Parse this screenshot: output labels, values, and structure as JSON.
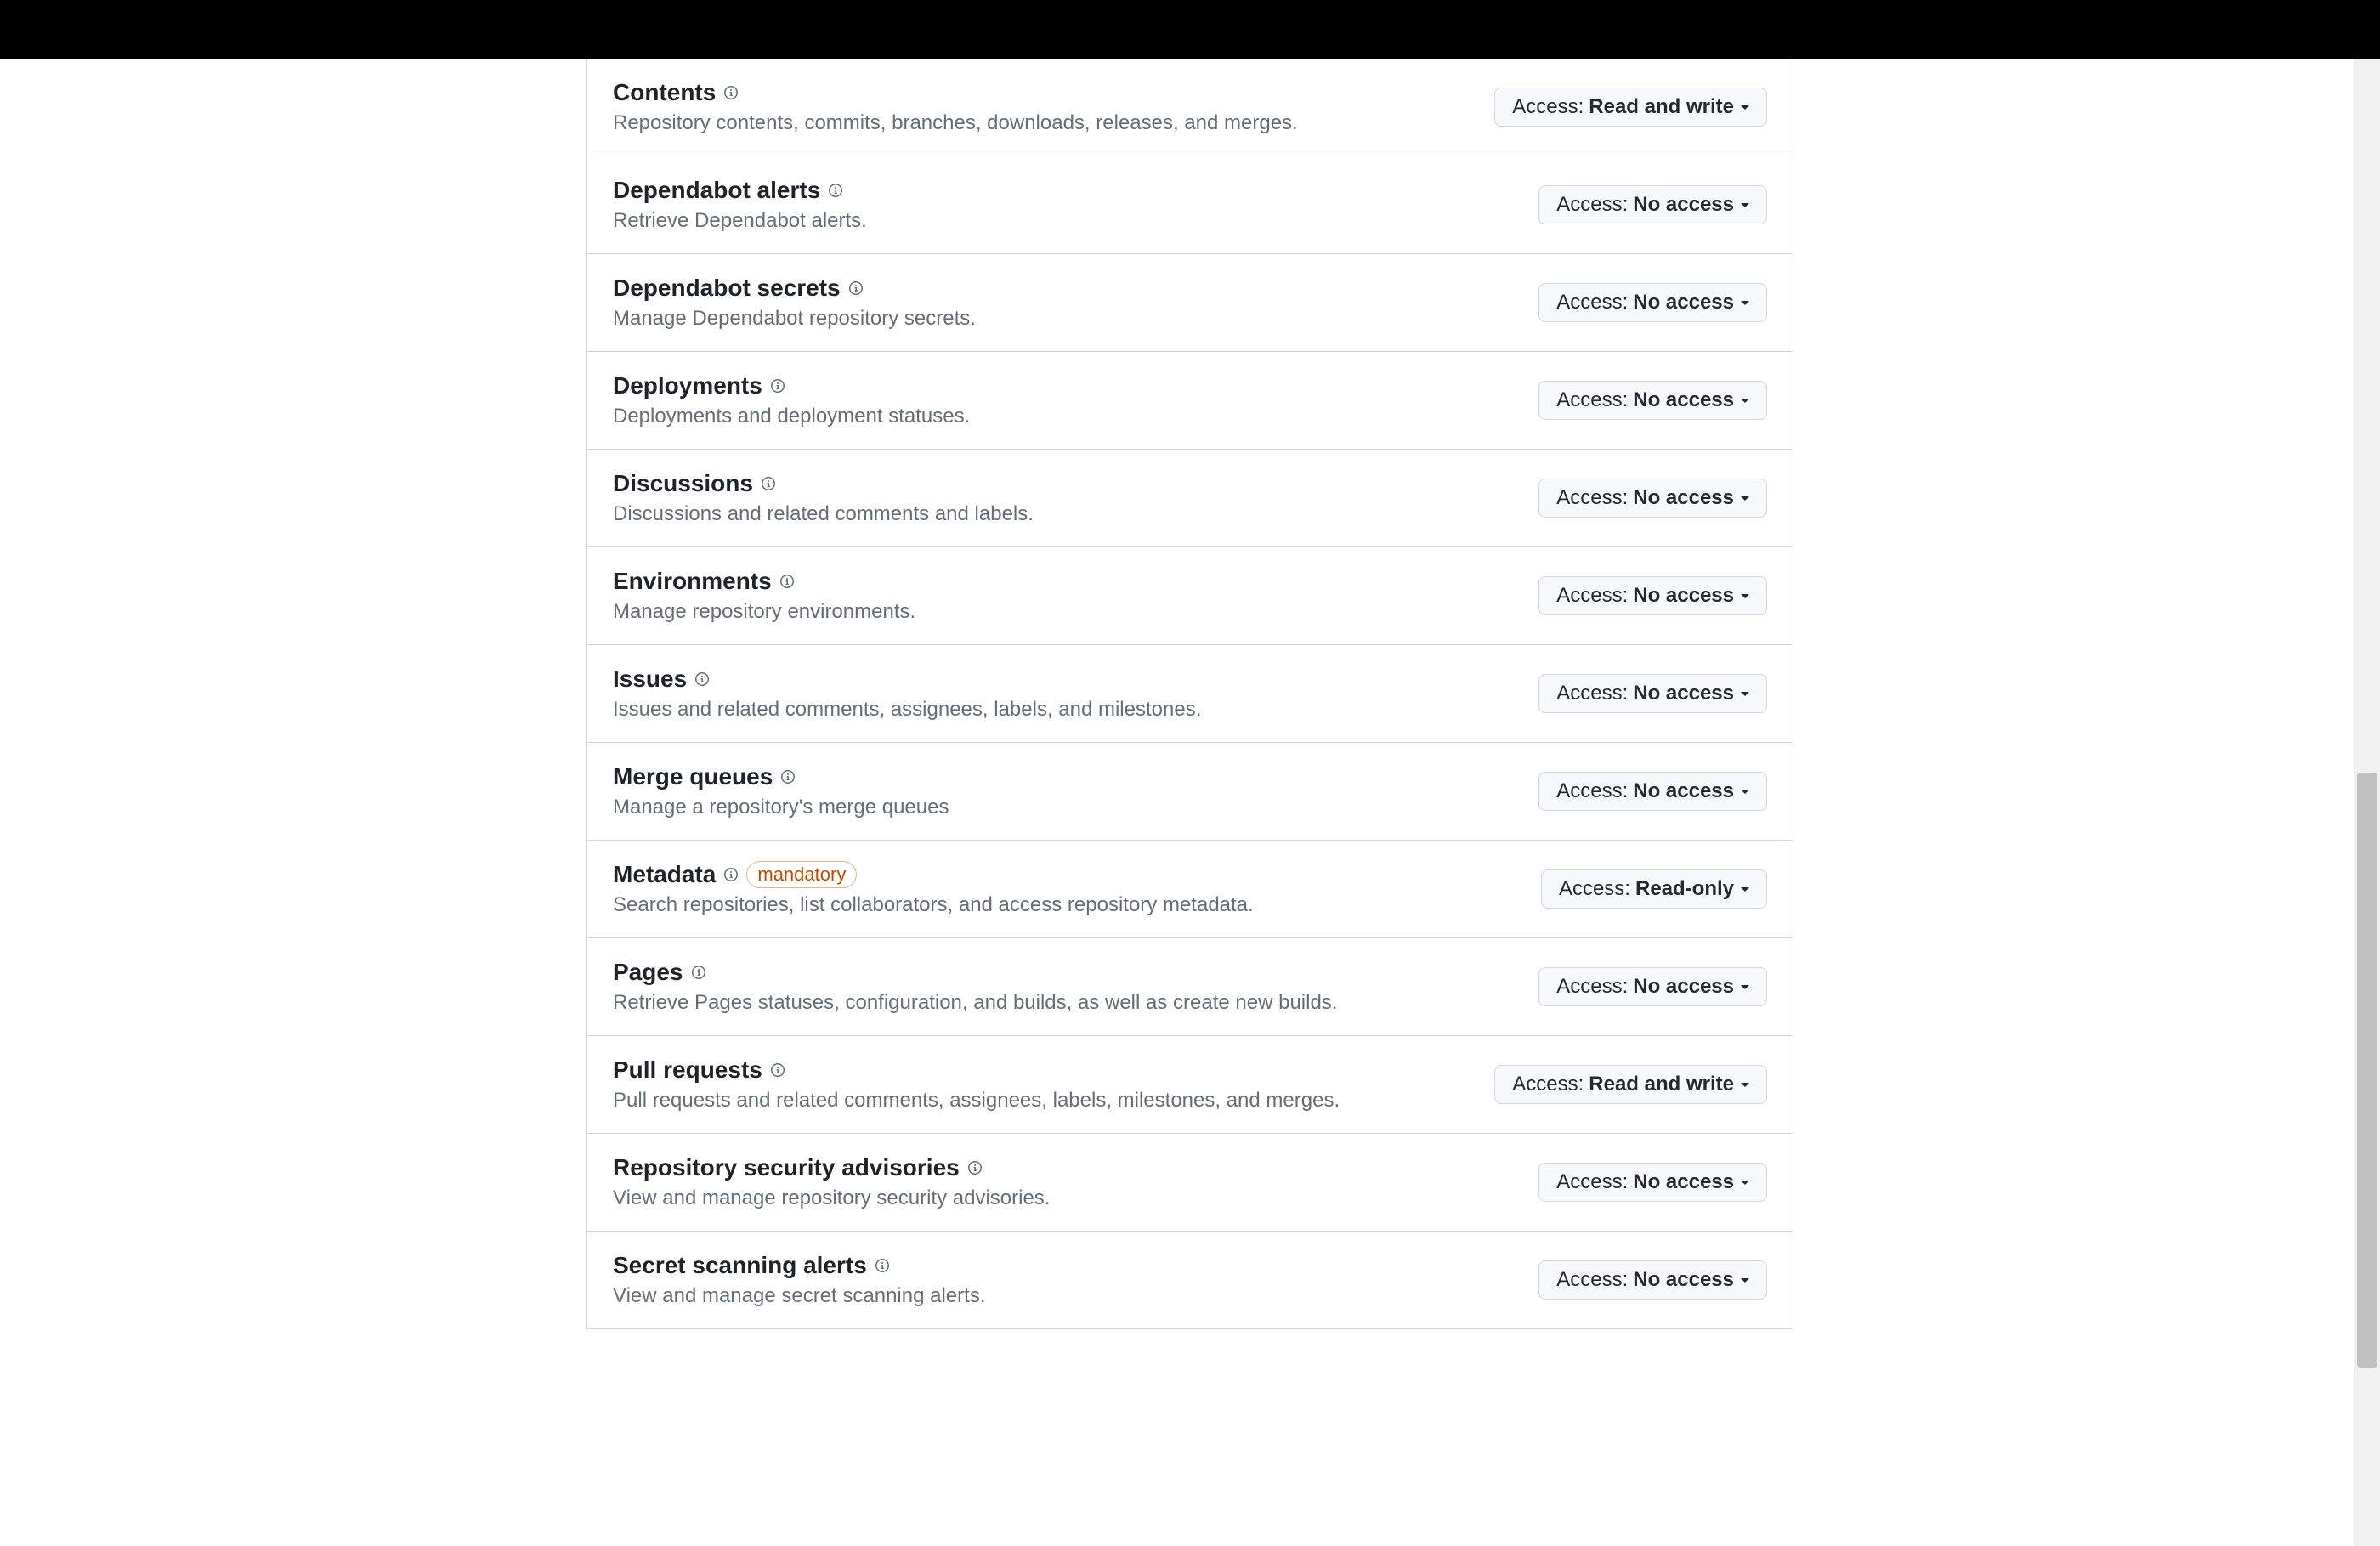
{
  "access_label_prefix": "Access: ",
  "badge_mandatory": "mandatory",
  "permissions": [
    {
      "title": "Contents",
      "desc": "Repository contents, commits, branches, downloads, releases, and merges.",
      "access": "Read and write",
      "badge": null
    },
    {
      "title": "Dependabot alerts",
      "desc": "Retrieve Dependabot alerts.",
      "access": "No access",
      "badge": null
    },
    {
      "title": "Dependabot secrets",
      "desc": "Manage Dependabot repository secrets.",
      "access": "No access",
      "badge": null
    },
    {
      "title": "Deployments",
      "desc": "Deployments and deployment statuses.",
      "access": "No access",
      "badge": null
    },
    {
      "title": "Discussions",
      "desc": "Discussions and related comments and labels.",
      "access": "No access",
      "badge": null
    },
    {
      "title": "Environments",
      "desc": "Manage repository environments.",
      "access": "No access",
      "badge": null
    },
    {
      "title": "Issues",
      "desc": "Issues and related comments, assignees, labels, and milestones.",
      "access": "No access",
      "badge": null
    },
    {
      "title": "Merge queues",
      "desc": "Manage a repository's merge queues",
      "access": "No access",
      "badge": null
    },
    {
      "title": "Metadata",
      "desc": "Search repositories, list collaborators, and access repository metadata.",
      "access": "Read-only",
      "badge": "mandatory"
    },
    {
      "title": "Pages",
      "desc": "Retrieve Pages statuses, configuration, and builds, as well as create new builds.",
      "access": "No access",
      "badge": null
    },
    {
      "title": "Pull requests",
      "desc": "Pull requests and related comments, assignees, labels, milestones, and merges.",
      "access": "Read and write",
      "badge": null
    },
    {
      "title": "Repository security advisories",
      "desc": "View and manage repository security advisories.",
      "access": "No access",
      "badge": null
    },
    {
      "title": "Secret scanning alerts",
      "desc": "View and manage secret scanning alerts.",
      "access": "No access",
      "badge": null
    }
  ]
}
